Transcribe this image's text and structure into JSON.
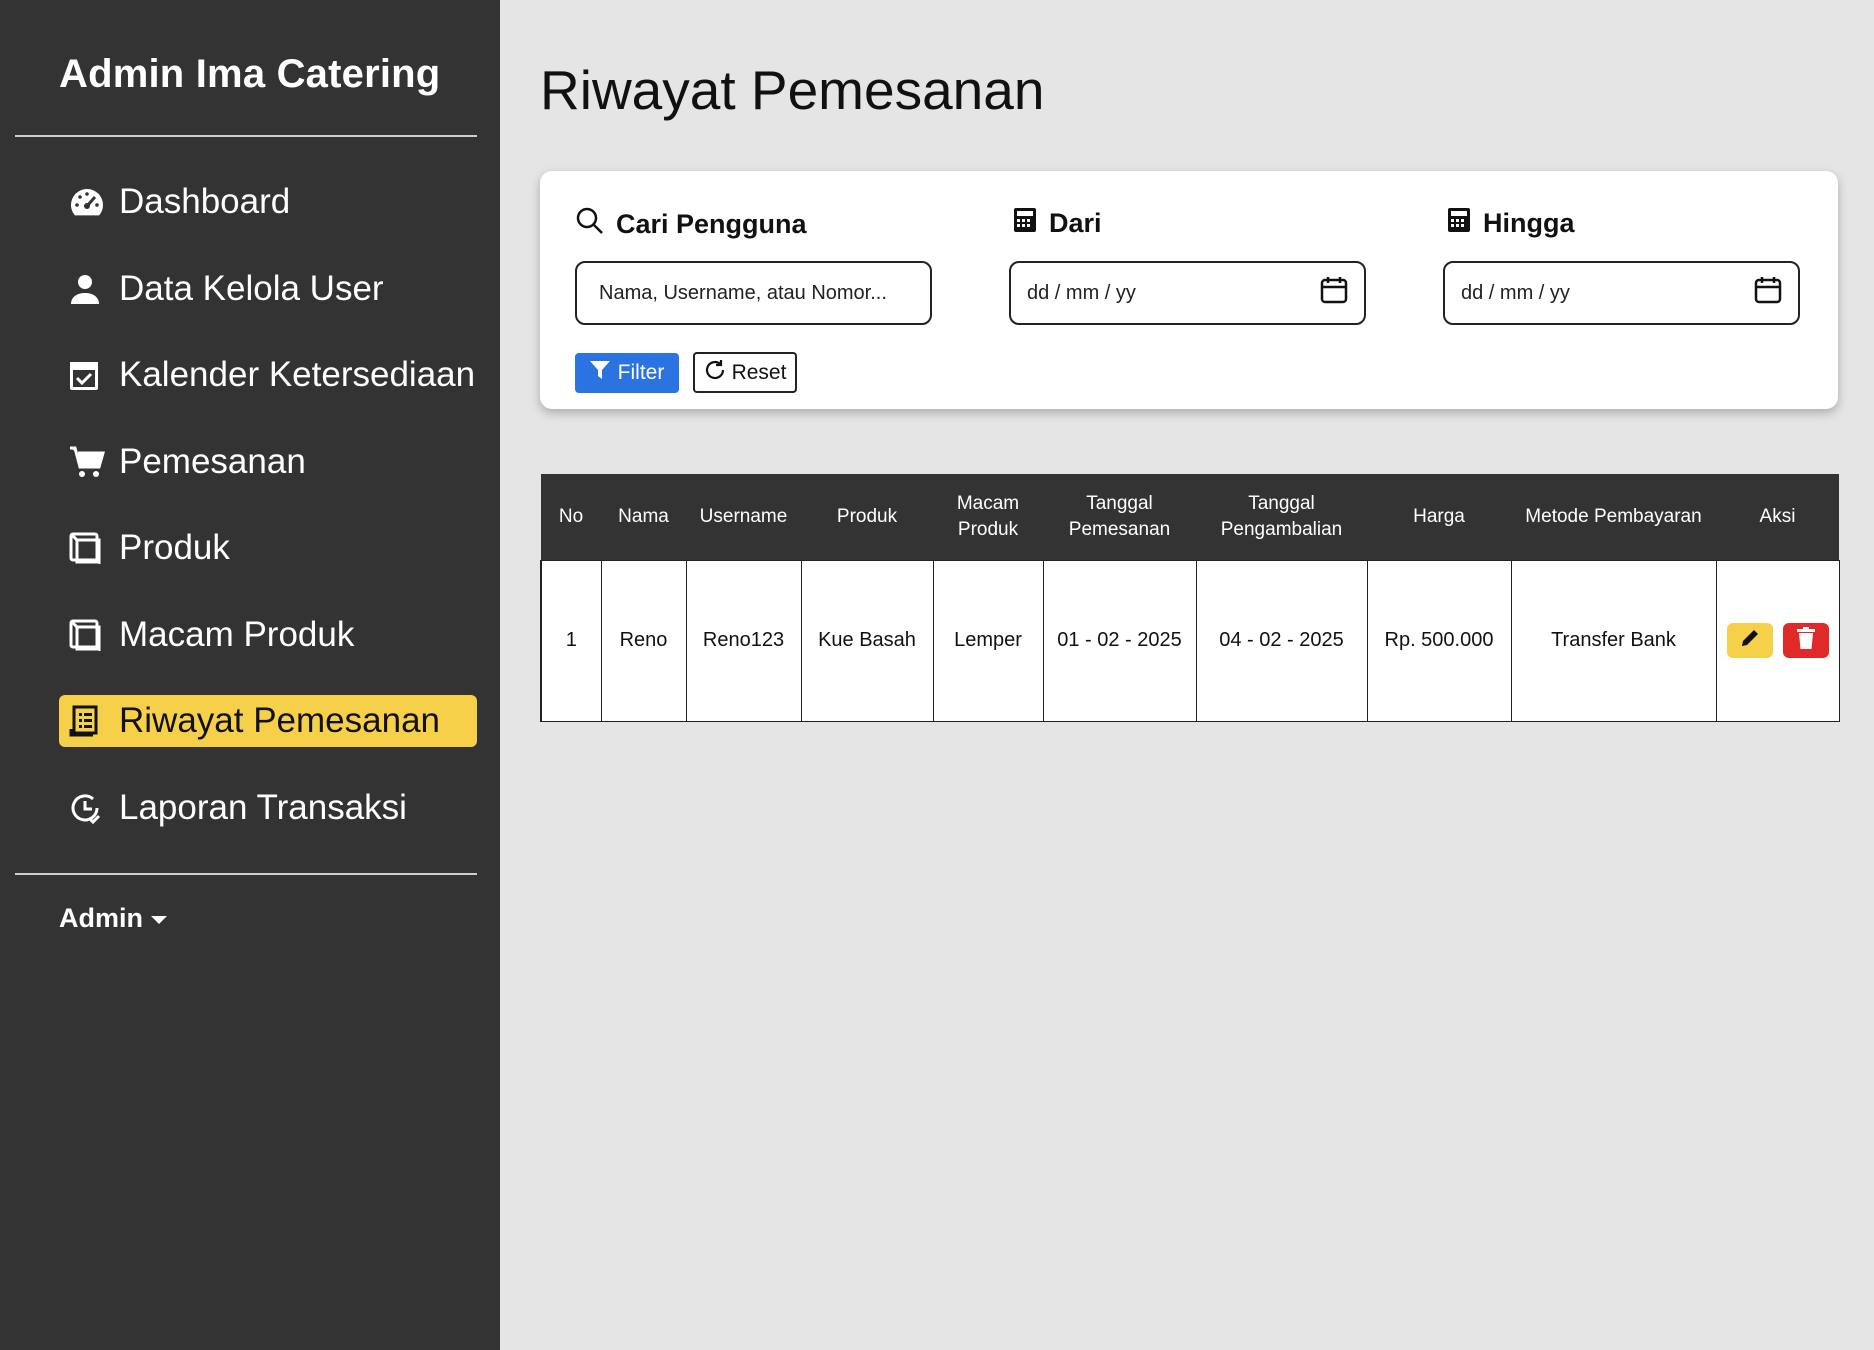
{
  "sidebar": {
    "brand": "Admin Ima Catering",
    "items": [
      {
        "label": "Dashboard",
        "icon": "gauge-icon"
      },
      {
        "label": "Data Kelola User",
        "icon": "user-icon"
      },
      {
        "label": "Kalender Ketersediaan",
        "icon": "calendar-check-icon"
      },
      {
        "label": "Pemesanan",
        "icon": "cart-icon"
      },
      {
        "label": "Produk",
        "icon": "box-icon"
      },
      {
        "label": "Macam Produk",
        "icon": "box-icon"
      },
      {
        "label": "Riwayat Pemesanan",
        "icon": "receipt-icon",
        "active": true
      },
      {
        "label": "Laporan Transaksi",
        "icon": "clock-report-icon"
      }
    ],
    "account": "Admin"
  },
  "main": {
    "title": "Riwayat Pemesanan",
    "filters": {
      "search_label": "Cari Pengguna",
      "search_placeholder": "Nama, Username, atau Nomor...",
      "from_label": "Dari",
      "from_placeholder": "dd / mm / yy",
      "to_label": "Hingga",
      "to_placeholder": "dd / mm / yy",
      "filter_button": "Filter",
      "reset_button": "Reset"
    },
    "table": {
      "headers": [
        "No",
        "Nama",
        "Username",
        "Produk",
        "Macam Produk",
        "Tanggal Pemesanan",
        "Tanggal Pengambalian",
        "Harga",
        "Metode Pembayaran",
        "Aksi"
      ],
      "rows": [
        [
          "1",
          "Reno",
          "Reno123",
          "Kue Basah",
          "Lemper",
          "01 - 02 - 2025",
          "04 - 02 - 2025",
          "Rp. 500.000",
          "Transfer Bank"
        ]
      ]
    }
  },
  "colors": {
    "sidebar_bg": "#333333",
    "active_bg": "#f7d04a",
    "filter_btn": "#2a73e0",
    "delete_btn": "#e02a2a",
    "page_bg": "#e5e5e5"
  }
}
